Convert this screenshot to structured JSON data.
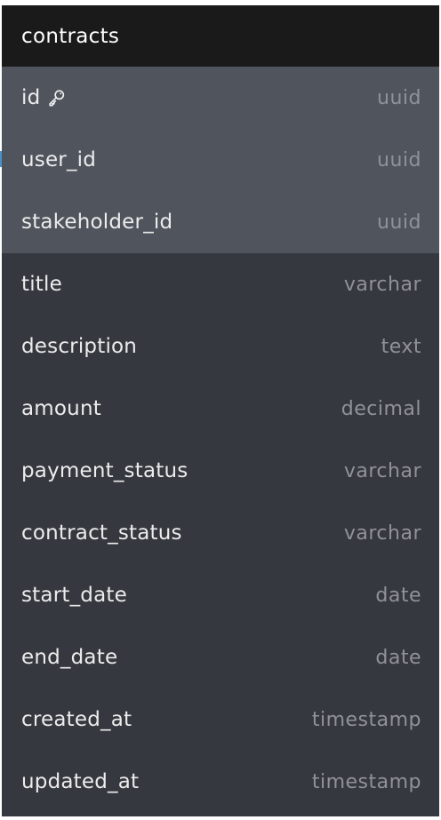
{
  "table": {
    "title": "contracts",
    "columns": [
      {
        "name": "id",
        "type": "uuid",
        "primary_key": true,
        "highlight": true
      },
      {
        "name": "user_id",
        "type": "uuid",
        "highlight": true
      },
      {
        "name": "stakeholder_id",
        "type": "uuid",
        "highlight": true
      },
      {
        "name": "title",
        "type": "varchar"
      },
      {
        "name": "description",
        "type": "text"
      },
      {
        "name": "amount",
        "type": "decimal"
      },
      {
        "name": "payment_status",
        "type": "varchar"
      },
      {
        "name": "contract_status",
        "type": "varchar"
      },
      {
        "name": "start_date",
        "type": "date"
      },
      {
        "name": "end_date",
        "type": "date"
      },
      {
        "name": "created_at",
        "type": "timestamp"
      },
      {
        "name": "updated_at",
        "type": "timestamp"
      }
    ]
  },
  "colors": {
    "header_bg": "#1a1a1a",
    "body_bg": "#36383f",
    "highlight_bg": "#50555d",
    "name_text": "#ececec",
    "type_text": "#8f9296",
    "connector": "#4a90c8"
  },
  "icons": {
    "primary_key": "key-icon"
  }
}
